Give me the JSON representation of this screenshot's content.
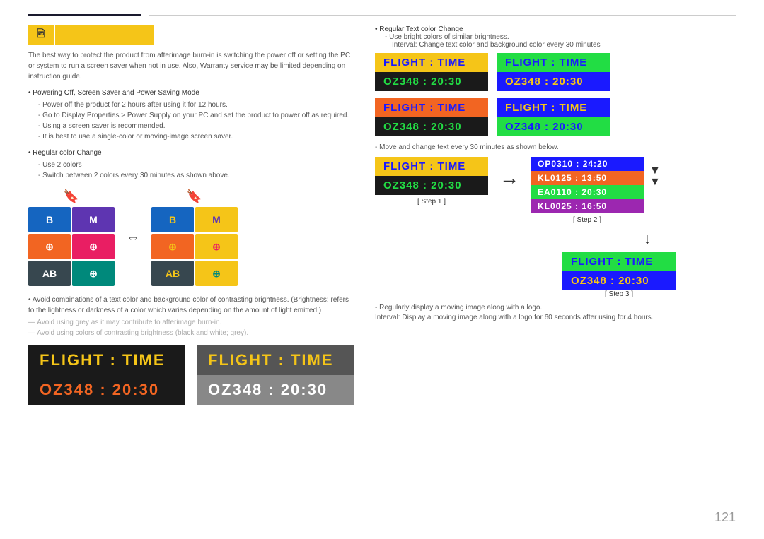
{
  "page": {
    "number": "121",
    "section_icon_char": "🖻"
  },
  "top_bar": {},
  "left": {
    "body_text": "The best way to protect the product from afterimage burn-in is switching the power off or setting the PC or system to run a screen saver when not in use. Also, Warranty service may be limited depending on instruction guide.",
    "bullets": [
      {
        "label": "Powering Off, Screen Saver and Power Saving Mode",
        "sub_items": [
          "Power off the product for 2 hours after using it for 12 hours.",
          "Go to Display Properties > Power Supply on your PC and set the product to power off as required.",
          "Using a screen saver is recommended.",
          "It is best to use a single-color or moving-image screen saver."
        ]
      },
      {
        "label": "Regular color Change",
        "sub_items": [
          "Use 2 colors",
          "Switch between 2 colors every 30 minutes as shown above."
        ]
      }
    ],
    "avoid_lines": [
      "Avoid combinations of a text color and background color of contrasting brightness. (Brightness: refers to the lightness or darkness of a color which varies depending on the amount of light emitted.)",
      "Avoid using grey as it may contribute to afterimage burn-in.",
      "Avoid using colors of contrasting brightness (black and white; grey)."
    ],
    "large_panels": [
      {
        "id": "dark",
        "row1_bg": "#1a1a1a",
        "row1_color": "#f5c518",
        "row1_text": "FLIGHT   :   TIME",
        "row2_bg": "#1a1a1a",
        "row2_color": "#f26522",
        "row2_text": "OZ348   :   20:30"
      },
      {
        "id": "gray",
        "row1_bg": "#555",
        "row1_color": "#f5c518",
        "row1_text": "FLIGHT   :   TIME",
        "row2_bg": "#888",
        "row2_color": "#fff",
        "row2_text": "OZ348   :   20:30"
      }
    ]
  },
  "color_grid_1": {
    "cells": [
      {
        "bg": "#1565C0",
        "color": "#fff",
        "text": "B"
      },
      {
        "bg": "#5E35B1",
        "color": "#fff",
        "text": "M"
      },
      {
        "bg": "#f26522",
        "color": "#fff",
        "text": "⊕"
      },
      {
        "bg": "#e91e63",
        "color": "#fff",
        "text": "⊕"
      },
      {
        "bg": "#37474F",
        "color": "#fff",
        "text": "AB"
      },
      {
        "bg": "#00897B",
        "color": "#fff",
        "text": "⊕"
      }
    ]
  },
  "color_grid_2": {
    "cells": [
      {
        "bg": "#1565C0",
        "color": "#f5c518",
        "text": "B"
      },
      {
        "bg": "#f5c518",
        "color": "#5E35B1",
        "text": "M"
      },
      {
        "bg": "#f26522",
        "color": "#f5c518",
        "text": "⊕"
      },
      {
        "bg": "#f5c518",
        "color": "#e91e63",
        "text": "⊕"
      },
      {
        "bg": "#37474F",
        "color": "#f5c518",
        "text": "AB"
      },
      {
        "bg": "#f5c518",
        "color": "#00897B",
        "text": "⊕"
      }
    ]
  },
  "right": {
    "bullet_text": "Regular Text color Change",
    "sub1": "Use bright colors of similar brightness.",
    "sub2": "Interval: Change text color and background color every 30 minutes",
    "panel_pairs": [
      {
        "panels": [
          {
            "row1_bg": "#f5c518",
            "row1_color": "#1a1aff",
            "row1_text": "FLIGHT   :   TIME",
            "row2_bg": "#1a1a1a",
            "row2_color": "#22dd44",
            "row2_text": "OZ348   :   20:30"
          },
          {
            "row1_bg": "#22dd44",
            "row1_color": "#1a1aff",
            "row1_text": "FLIGHT   :   TIME",
            "row2_bg": "#1a1aff",
            "row2_color": "#f5c518",
            "row2_text": "OZ348   :   20:30"
          }
        ]
      },
      {
        "panels": [
          {
            "row1_bg": "#f26522",
            "row1_color": "#1a1aff",
            "row1_text": "FLIGHT   :   TIME",
            "row2_bg": "#1a1a1a",
            "row2_color": "#22dd44",
            "row2_text": "OZ348   :   20:30"
          },
          {
            "row1_bg": "#1a1aff",
            "row1_color": "#f5c518",
            "row1_text": "FLIGHT   :   TIME",
            "row2_bg": "#22dd44",
            "row2_color": "#1a1aff",
            "row2_text": "OZ348   :   20:30"
          }
        ]
      }
    ],
    "move_text": "Move and change text every 30 minutes as shown below.",
    "step1": {
      "label": "[ Step 1 ]",
      "panel": {
        "row1_bg": "#f5c518",
        "row1_color": "#1a1aff",
        "row1_text": "FLIGHT   :   TIME",
        "row2_bg": "#1a1a1a",
        "row2_color": "#22dd44",
        "row2_text": "OZ348   :   20:30"
      }
    },
    "step2": {
      "label": "[ Step 2 ]",
      "scroll_rows": [
        {
          "bg": "#1a1aff",
          "text": "OP0310 :  24:20"
        },
        {
          "bg": "#f26522",
          "text": "KL0125 :  13:50"
        },
        {
          "bg": "#22dd44",
          "text": "EA0110 :  20:30"
        },
        {
          "bg": "#9c27b0",
          "text": "KL0025 :  16:50"
        }
      ]
    },
    "step3": {
      "label": "[ Step 3 ]",
      "panel": {
        "row1_bg": "#22dd44",
        "row1_color": "#1a1aff",
        "row1_text": "FLIGHT   :   TIME",
        "row2_bg": "#1a1aff",
        "row2_color": "#f5c518",
        "row2_text": "OZ348   :   20:30"
      }
    },
    "final_bullets": [
      "Regularly display a moving image along with a logo.",
      "Interval: Display a moving image along with a logo for 60 seconds after using for 4 hours."
    ]
  }
}
